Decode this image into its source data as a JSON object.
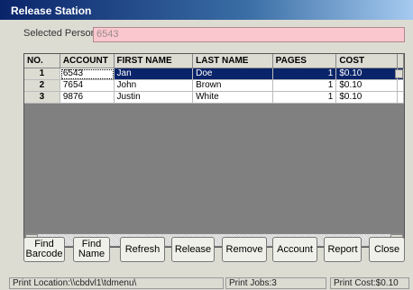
{
  "window": {
    "title": "Release Station"
  },
  "selected_person": {
    "label": "Selected Person:",
    "value": "6543"
  },
  "grid": {
    "columns": [
      "NO.",
      "ACCOUNT",
      "FIRST NAME",
      "LAST NAME",
      "PAGES",
      "COST"
    ],
    "rows": [
      {
        "no": "1",
        "account": "6543",
        "first": "Jan",
        "last": "Doe",
        "pages": "1",
        "cost": "$0.10"
      },
      {
        "no": "2",
        "account": "7654",
        "first": "John",
        "last": "Brown",
        "pages": "1",
        "cost": "$0.10"
      },
      {
        "no": "3",
        "account": "9876",
        "first": "Justin",
        "last": "White",
        "pages": "1",
        "cost": "$0.10"
      }
    ],
    "scroll_left_glyph": "◄",
    "scroll_right_glyph": "►"
  },
  "buttons": {
    "find_barcode": "Find Barcode",
    "find_name": "Find Name",
    "refresh": "Refresh",
    "release": "Release",
    "remove": "Remove",
    "account": "Account",
    "report": "Report",
    "close": "Close"
  },
  "status": {
    "print_location": "Print Location:\\\\cbdvl1\\tdmenu\\",
    "print_jobs": "Print Jobs:3",
    "print_cost": "Print Cost:$0.10"
  },
  "colors": {
    "selection": "#0a246a",
    "selected_person_field": "#f9c7cd",
    "grid_empty": "#808080"
  }
}
